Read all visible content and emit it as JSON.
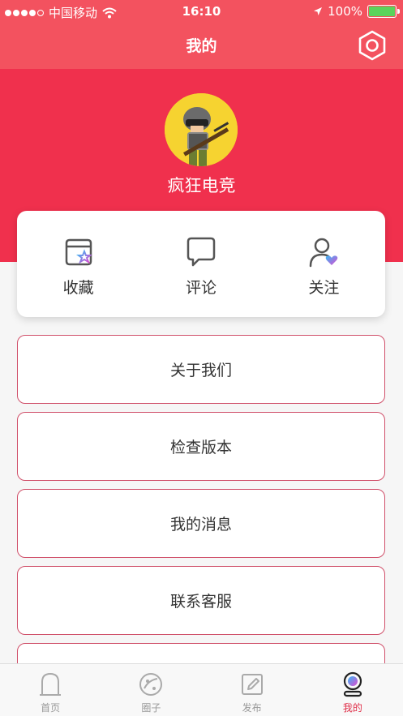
{
  "status": {
    "carrier": "中国移动",
    "time": "16:10",
    "battery": "100%"
  },
  "nav": {
    "title": "我的"
  },
  "profile": {
    "username": "疯狂电竞"
  },
  "actions": [
    {
      "label": "收藏",
      "icon": "favorites-icon"
    },
    {
      "label": "评论",
      "icon": "comment-icon"
    },
    {
      "label": "关注",
      "icon": "follow-icon"
    }
  ],
  "menu": [
    {
      "label": "关于我们"
    },
    {
      "label": "检查版本"
    },
    {
      "label": "我的消息"
    },
    {
      "label": "联系客服"
    }
  ],
  "tabs": [
    {
      "label": "首页",
      "icon": "home-icon"
    },
    {
      "label": "圈子",
      "icon": "planet-icon"
    },
    {
      "label": "发布",
      "icon": "edit-icon"
    },
    {
      "label": "我的",
      "icon": "profile-icon",
      "active": true
    }
  ],
  "colors": {
    "primary": "#f3525f",
    "hero": "#f0304d",
    "accent_border": "#d0506a",
    "active_tab": "#e0304a"
  }
}
